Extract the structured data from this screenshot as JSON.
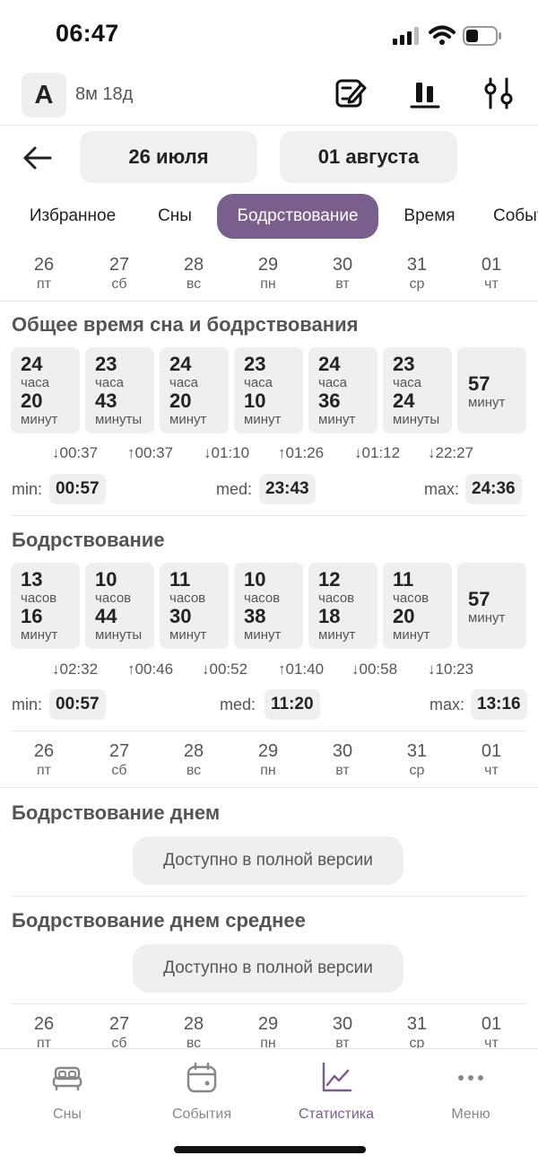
{
  "status": {
    "time": "06:47"
  },
  "header": {
    "avatar_letter": "A",
    "age": "8м 18д"
  },
  "date_range": {
    "from": "26 июля",
    "to": "01 августа"
  },
  "tabs": [
    {
      "label": "Избранное"
    },
    {
      "label": "Сны"
    },
    {
      "label": "Бодрствование",
      "active": true
    },
    {
      "label": "Время"
    },
    {
      "label": "События"
    }
  ],
  "days": [
    {
      "num": "26",
      "wd": "пт"
    },
    {
      "num": "27",
      "wd": "сб"
    },
    {
      "num": "28",
      "wd": "вс"
    },
    {
      "num": "29",
      "wd": "пн"
    },
    {
      "num": "30",
      "wd": "вт"
    },
    {
      "num": "31",
      "wd": "ср"
    },
    {
      "num": "01",
      "wd": "чт"
    }
  ],
  "total": {
    "title": "Общее время сна и бодрствования",
    "tiles": [
      {
        "h": "24",
        "hu": "часа",
        "m": "20",
        "mu": "минут"
      },
      {
        "h": "23",
        "hu": "часа",
        "m": "43",
        "mu": "минуты"
      },
      {
        "h": "24",
        "hu": "часа",
        "m": "20",
        "mu": "минут"
      },
      {
        "h": "23",
        "hu": "часа",
        "m": "10",
        "mu": "минут"
      },
      {
        "h": "24",
        "hu": "часа",
        "m": "36",
        "mu": "минут"
      },
      {
        "h": "23",
        "hu": "часа",
        "m": "24",
        "mu": "минуты"
      },
      {
        "m": "57",
        "mu": "минут"
      }
    ],
    "deltas": [
      "↓00:37",
      "↑00:37",
      "↓01:10",
      "↑01:26",
      "↓01:12",
      "↓22:27"
    ],
    "min_label": "min:",
    "min": "00:57",
    "med_label": "med:",
    "med": "23:43",
    "max_label": "max:",
    "max": "24:36"
  },
  "awake": {
    "title": "Бодрствование",
    "tiles": [
      {
        "h": "13",
        "hu": "часов",
        "m": "16",
        "mu": "минут"
      },
      {
        "h": "10",
        "hu": "часов",
        "m": "44",
        "mu": "минуты"
      },
      {
        "h": "11",
        "hu": "часов",
        "m": "30",
        "mu": "минут"
      },
      {
        "h": "10",
        "hu": "часов",
        "m": "38",
        "mu": "минут"
      },
      {
        "h": "12",
        "hu": "часов",
        "m": "18",
        "mu": "минут"
      },
      {
        "h": "11",
        "hu": "часов",
        "m": "20",
        "mu": "минут"
      },
      {
        "m": "57",
        "mu": "минут"
      }
    ],
    "deltas": [
      "↓02:32",
      "↑00:46",
      "↓00:52",
      "↑01:40",
      "↓00:58",
      "↓10:23"
    ],
    "min_label": "min:",
    "min": "00:57",
    "med_label": "med:",
    "med": "11:20",
    "max_label": "max:",
    "max": "13:16"
  },
  "day_awake": {
    "title": "Бодрствование днем",
    "locked": "Доступно в полной версии"
  },
  "day_awake_avg": {
    "title": "Бодрствование днем среднее",
    "locked": "Доступно в полной версии"
  },
  "nav": [
    {
      "label": "Сны",
      "icon": "bed-icon"
    },
    {
      "label": "События",
      "icon": "calendar-icon"
    },
    {
      "label": "Статистика",
      "icon": "chart-icon",
      "active": true
    },
    {
      "label": "Меню",
      "icon": "more-icon"
    }
  ]
}
